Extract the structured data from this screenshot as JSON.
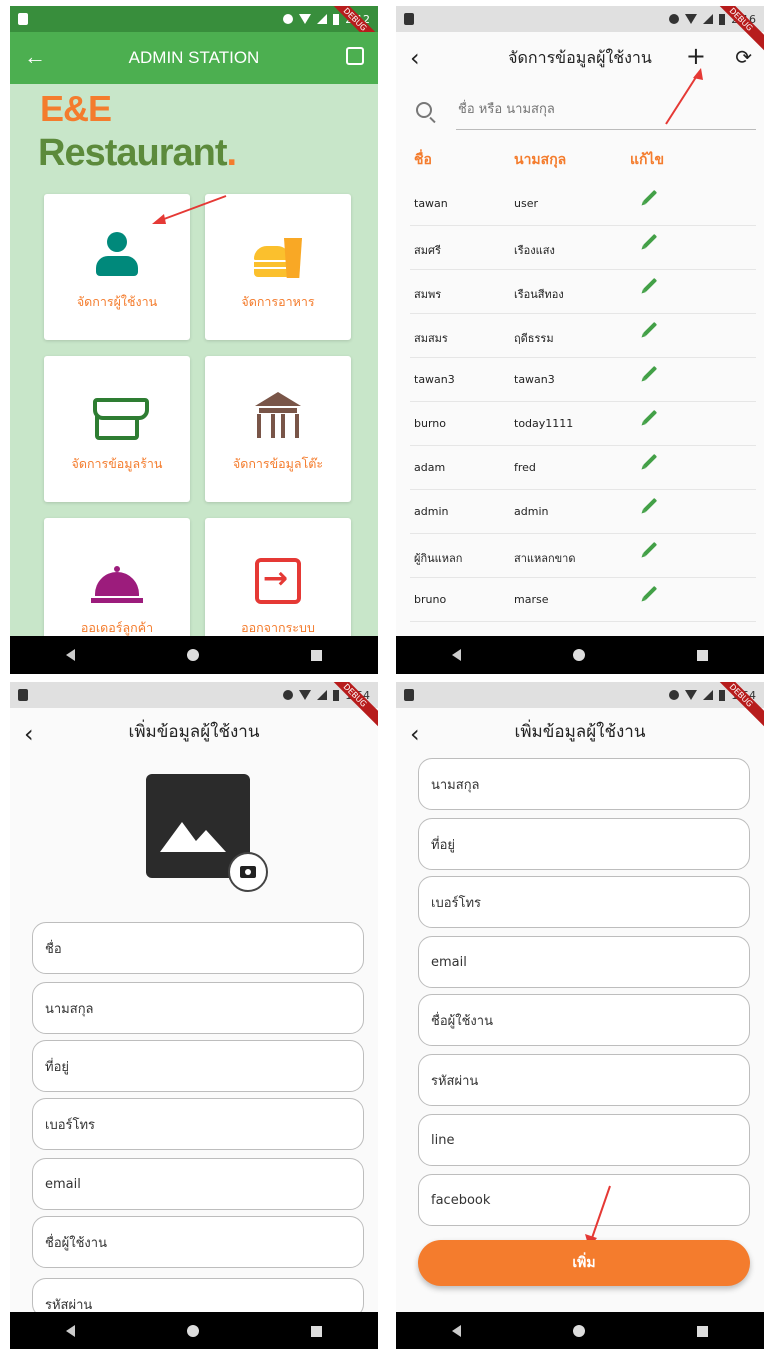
{
  "debug_banner": "DEBUG",
  "panel1": {
    "status_time": "2:12",
    "appbar_title": "ADMIN STATION",
    "brand_line1": "E&E",
    "brand_line2": "Restaurant",
    "brand_dot": ".",
    "tiles": [
      {
        "label": "จัดการผู้ใช้งาน",
        "icon": "user-icon",
        "color": "#00897b"
      },
      {
        "label": "จัดการอาหาร",
        "icon": "burger-drink-icon",
        "color": "#fbc02d"
      },
      {
        "label": "จัดการข้อมูลร้าน",
        "icon": "store-icon",
        "color": "#2e7d32"
      },
      {
        "label": "จัดการข้อมูลโต๊ะ",
        "icon": "table-icon",
        "color": "#795548"
      },
      {
        "label": "ออเดอร์ลูกค้า",
        "icon": "cloche-icon",
        "color": "#9c1c7c"
      },
      {
        "label": "ออกจากระบบ",
        "icon": "logout-icon",
        "color": "#e53935"
      }
    ]
  },
  "panel2": {
    "status_time": "2:16",
    "appbar_title": "จัดการข้อมูลผู้ใช้งาน",
    "search_placeholder": "ชื่อ หรือ นามสกุล",
    "columns": [
      "ชื่อ",
      "นามสกุล",
      "แก้ไข"
    ],
    "rows": [
      {
        "first": "tawan",
        "last": "user"
      },
      {
        "first": "สมศรี",
        "last": "เรืองแสง"
      },
      {
        "first": "สมพร",
        "last": "เรือนสีทอง"
      },
      {
        "first": "สมสมร",
        "last": "ฤดีธรรม"
      },
      {
        "first": "tawan3",
        "last": "tawan3"
      },
      {
        "first": "burno",
        "last": "today1111"
      },
      {
        "first": "adam",
        "last": "fred"
      },
      {
        "first": "admin",
        "last": "admin"
      },
      {
        "first": "ผู้กินแหลก",
        "last": "สาแหลกขาด"
      },
      {
        "first": "bruno",
        "last": "marse"
      }
    ]
  },
  "panel3": {
    "status_time": "1:54",
    "appbar_title": "เพิ่มข้อมูลผู้ใช้งาน",
    "fields": [
      "ชื่อ",
      "นามสกุล",
      "ที่อยู่",
      "เบอร์โทร",
      "email",
      "ชื่อผู้ใช้งาน",
      "รหัสผ่าน"
    ]
  },
  "panel4": {
    "status_time": "1:54",
    "appbar_title": "เพิ่มข้อมูลผู้ใช้งาน",
    "fields": [
      "นามสกุล",
      "ที่อยู่",
      "เบอร์โทร",
      "email",
      "ชื่อผู้ใช้งาน",
      "รหัสผ่าน",
      "line",
      "facebook"
    ],
    "add_button": "เพิ่ม"
  },
  "colors": {
    "accent": "#f47c2d",
    "green_appbar": "#4caf50",
    "green_bg": "#c8e6c9",
    "edit_icon": "#43a047"
  }
}
